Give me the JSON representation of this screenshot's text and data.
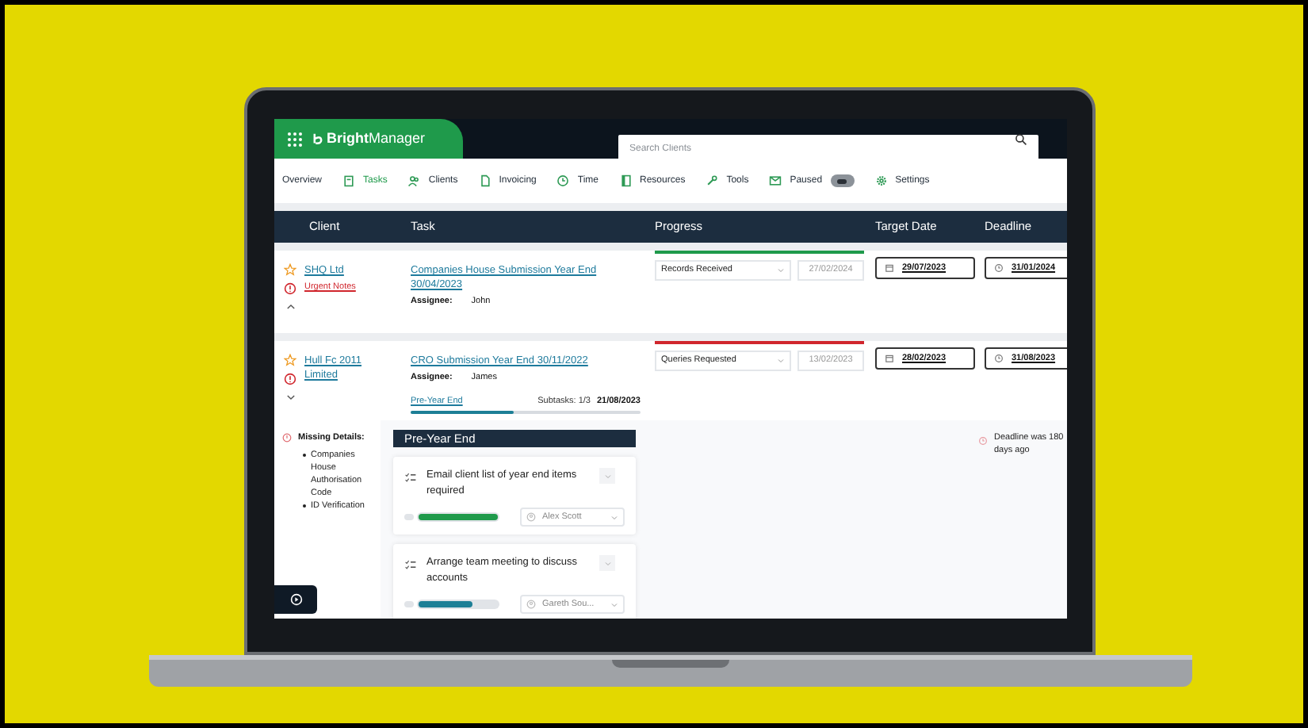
{
  "header": {
    "brand": "Bright",
    "product": "Manager",
    "search": {
      "placeholder": "Search Clients"
    }
  },
  "nav": [
    {
      "label": "Overview",
      "kind": "link",
      "selected": false
    },
    {
      "label": "Tasks",
      "kind": "link",
      "selected": true
    },
    {
      "label": "Clients",
      "kind": "link",
      "selected": false
    },
    {
      "label": "Invoicing",
      "kind": "link",
      "selected": false
    },
    {
      "label": "Time",
      "kind": "link",
      "selected": false
    },
    {
      "label": "Resources",
      "kind": "link",
      "selected": false
    },
    {
      "label": "Tools",
      "kind": "link",
      "selected": false
    },
    {
      "label": "Paused",
      "kind": "toggle",
      "selected": false
    },
    {
      "label": "Settings",
      "kind": "link",
      "selected": false
    }
  ],
  "table": {
    "columns": [
      "Client",
      "Task",
      "Progress",
      "Target Date",
      "Deadline"
    ],
    "rows": [
      {
        "client": "SHQ Ltd",
        "note": "Urgent Notes",
        "expanded": true,
        "task": "Companies House Submission Year End 30/04/2023",
        "assignee_label": "Assignee:",
        "assignee": "John",
        "status": "Records Received",
        "color": "#1f9a4b",
        "status_date": "27/02/2024",
        "target_date": "29/07/2023",
        "deadline": "31/01/2024"
      },
      {
        "client": "Hull Fc 2011 Limited",
        "expanded": false,
        "task": "CRO Submission Year End 30/11/2022",
        "assignee_label": "Assignee:",
        "assignee": "James",
        "stage": "Pre-Year End",
        "subtasks": "Subtasks: 1/3",
        "stage_date": "21/08/2023",
        "level": 0.45,
        "status": "Queries Requested",
        "color": "#d0262d",
        "status_date": "13/02/2023",
        "target_date": "28/02/2023",
        "deadline": "31/08/2023"
      }
    ]
  },
  "details": {
    "missing_title": "Missing Details:",
    "missing_items": [
      "Companies House Authorisation Code",
      "ID Verification"
    ],
    "deadline_note": "Deadline was 180 days ago",
    "panel": {
      "title": "Pre-Year End",
      "tasks": [
        {
          "title": "Email client list of year end items required",
          "level": 1,
          "color": "#1f9a4b",
          "assignee": "Alex Scott"
        },
        {
          "title": "Arrange team meeting to discuss accounts",
          "level": 0.67,
          "color": "#1d7f96",
          "assignee": "Gareth Sou..."
        }
      ]
    }
  }
}
